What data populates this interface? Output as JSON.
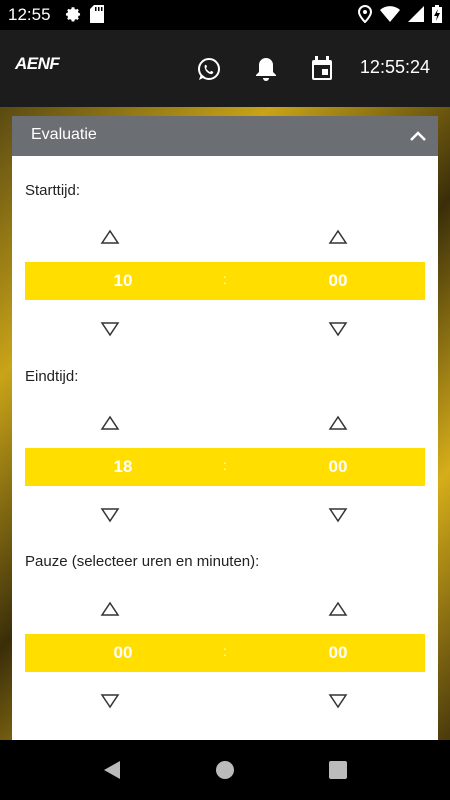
{
  "status_bar": {
    "time": "12:55",
    "icons": [
      "gear-icon",
      "sd-card-icon",
      "location-icon",
      "wifi-icon",
      "signal-icon",
      "battery-charging-icon"
    ]
  },
  "app_bar": {
    "logo": "AENF",
    "clock": "12:55:24",
    "icons": [
      "whatsapp-icon",
      "bell-icon",
      "calendar-icon"
    ]
  },
  "card": {
    "title": "Evaluatie",
    "sections": [
      {
        "label": "Starttijd:",
        "hours": "10",
        "separator": ":",
        "minutes": "00"
      },
      {
        "label": "Eindtijd:",
        "hours": "18",
        "separator": ":",
        "minutes": "00"
      },
      {
        "label": "Pauze (selecteer uren en minuten):",
        "hours": "00",
        "separator": ":",
        "minutes": "00"
      }
    ]
  },
  "nav_bar": {
    "icons": [
      "back-icon",
      "home-icon",
      "recents-icon"
    ]
  },
  "colors": {
    "accent_yellow": "#ffde00",
    "header_gray": "#6b6e73",
    "app_bar": "#1c1c1c"
  }
}
